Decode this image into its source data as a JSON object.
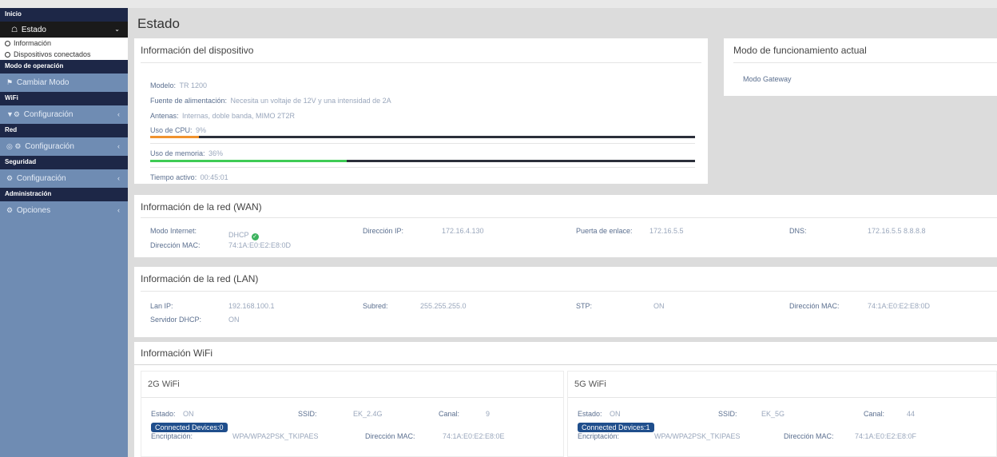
{
  "sidebar": {
    "inicio": "Inicio",
    "estado": "Estado",
    "informacion": "Información",
    "dispositivos": "Dispositivos conectados",
    "modo_operacion": "Modo de operación",
    "cambiar_modo": "Cambiar Modo",
    "wifi": "WiFi",
    "wifi_config": "Configuración",
    "red": "Red",
    "red_config": "Configuración",
    "seguridad": "Seguridad",
    "seg_config": "Configuración",
    "administracion": "Administración",
    "opciones": "Opciones"
  },
  "page": {
    "title": "Estado"
  },
  "device": {
    "title": "Información del dispositivo",
    "modelo_label": "Modelo:",
    "modelo_value": "TR 1200",
    "fuente_label": "Fuente de alimentación:",
    "fuente_value": "Necesita un voltaje de 12V y una intensidad de 2A",
    "antenas_label": "Antenas:",
    "antenas_value": "Internas, doble banda, MIMO 2T2R",
    "cpu_label": "Uso de CPU:",
    "cpu_value": "9%",
    "cpu_fraction": 0.09,
    "mem_label": "Uso de memoria:",
    "mem_value": "36%",
    "mem_fraction": 0.36,
    "uptime_label": "Tiempo activo:",
    "uptime_value": "00:45:01"
  },
  "mode": {
    "title": "Modo de funcionamiento actual",
    "value": "Modo Gateway"
  },
  "wan": {
    "title": "Información de la red (WAN)",
    "modo_label": "Modo Internet:",
    "modo_value": "DHCP",
    "ip_label": "Dirección IP:",
    "ip_value": "172.16.4.130",
    "gw_label": "Puerta de enlace:",
    "gw_value": "172.16.5.5",
    "dns_label": "DNS:",
    "dns_value": "172.16.5.5 8.8.8.8",
    "mac_label": "Dirección MAC:",
    "mac_value": "74:1A:E0:E2:E8:0D"
  },
  "lan": {
    "title": "Información de la red (LAN)",
    "ip_label": "Lan IP:",
    "ip_value": "192.168.100.1",
    "subnet_label": "Subred:",
    "subnet_value": "255.255.255.0",
    "stp_label": "STP:",
    "stp_value": "ON",
    "mac_label": "Dirección MAC:",
    "mac_value": "74:1A:E0:E2:E8:0D",
    "dhcp_label": "Servidor DHCP:",
    "dhcp_value": "ON"
  },
  "wifi": {
    "title": "Información WiFi",
    "g2": {
      "title": "2G WiFi",
      "estado_label": "Estado:",
      "estado_value": "ON",
      "ssid_label": "SSID:",
      "ssid_value": "EK_2.4G",
      "canal_label": "Canal:",
      "canal_value": "9",
      "devices": "Connected Devices:0",
      "enc_label": "Encriptación:",
      "enc_value": "WPA/WPA2PSK_TKIPAES",
      "mac_label": "Dirección MAC:",
      "mac_value": "74:1A:E0:E2:E8:0E"
    },
    "g5": {
      "title": "5G WiFi",
      "estado_label": "Estado:",
      "estado_value": "ON",
      "ssid_label": "SSID:",
      "ssid_value": "EK_5G",
      "canal_label": "Canal:",
      "canal_value": "44",
      "devices": "Connected Devices:1",
      "enc_label": "Encriptación:",
      "enc_value": "WPA/WPA2PSK_TKIPAES",
      "mac_label": "Dirección MAC:",
      "mac_value": "74:1A:E0:E2:E8:0F"
    }
  },
  "colors": {
    "cpu_bar": "#f0922e",
    "mem_bar": "#3ecb55",
    "sidebar": "#6f8cb3",
    "sidebar_header": "#1d2747"
  }
}
